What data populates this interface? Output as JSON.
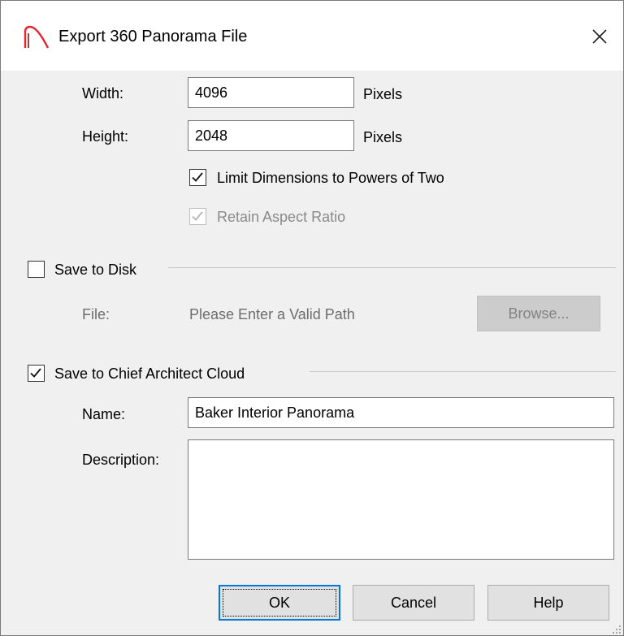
{
  "dialog": {
    "title": "Export 360 Panorama File"
  },
  "dimensions": {
    "width_label": "Width:",
    "width_value": "4096",
    "width_unit": "Pixels",
    "height_label": "Height:",
    "height_value": "2048",
    "height_unit": "Pixels",
    "powers_of_two_label": "Limit Dimensions to Powers of Two",
    "powers_of_two_checked": true,
    "aspect_ratio_label": "Retain Aspect Ratio",
    "aspect_ratio_checked": true,
    "aspect_ratio_enabled": false
  },
  "save_to_disk": {
    "label": "Save to Disk",
    "checked": false,
    "file_label": "File:",
    "file_placeholder": "Please Enter a Valid Path",
    "browse_label": "Browse..."
  },
  "save_to_cloud": {
    "label": "Save to Chief Architect Cloud",
    "checked": true,
    "name_label": "Name:",
    "name_value": "Baker Interior Panorama",
    "description_label": "Description:",
    "description_value": ""
  },
  "buttons": {
    "ok": "OK",
    "cancel": "Cancel",
    "help": "Help"
  },
  "colors": {
    "accent": "#0078d7",
    "app_icon": "#e3262d",
    "dialog_bg": "#f0f0f0"
  }
}
